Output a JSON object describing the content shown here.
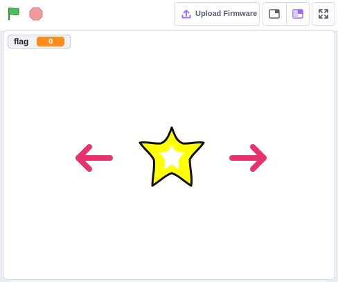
{
  "toolbar": {
    "upload_label": "Upload Firmware",
    "flag_icon": "green-flag-icon",
    "stop_icon": "stop-icon"
  },
  "monitor": {
    "label": "flag",
    "value": "0"
  },
  "colors": {
    "flag_green": "#4cbf56",
    "stop_red": "#ec9c9c",
    "upload_purple": "#9966ff",
    "monitor_orange": "#ff8c1a",
    "arrow_pink": "#e8326e",
    "star_yellow": "#ffff00"
  },
  "stage": {
    "sprites": [
      "left-arrow",
      "star",
      "right-arrow"
    ]
  }
}
